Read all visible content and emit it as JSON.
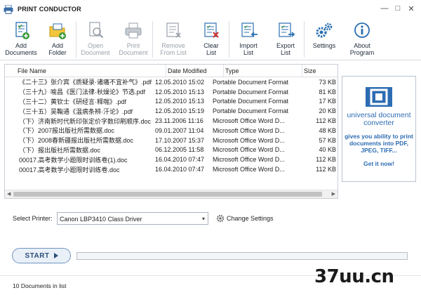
{
  "window": {
    "title": "PRINT CONDUCTOR",
    "minimize": "—",
    "restore": "□",
    "close": "✕"
  },
  "toolbar": [
    {
      "label": "Add\nDocuments",
      "icon": "add-documents-icon",
      "enabled": true
    },
    {
      "label": "Add\nFolder",
      "icon": "add-folder-icon",
      "enabled": true
    },
    {
      "label": "Open\nDocument",
      "icon": "open-document-icon",
      "enabled": false
    },
    {
      "label": "Print\nDocument",
      "icon": "print-document-icon",
      "enabled": false
    },
    {
      "label": "Remove\nFrom List",
      "icon": "remove-from-list-icon",
      "enabled": false
    },
    {
      "label": "Clear\nList",
      "icon": "clear-list-icon",
      "enabled": true
    },
    {
      "label": "Import\nList",
      "icon": "import-list-icon",
      "enabled": true
    },
    {
      "label": "Export\nList",
      "icon": "export-list-icon",
      "enabled": true
    },
    {
      "label": "Settings",
      "icon": "settings-icon",
      "enabled": true
    },
    {
      "label": "About\nProgram",
      "icon": "about-icon",
      "enabled": true
    }
  ],
  "table": {
    "columns": [
      "File Name",
      "Date Modified",
      "Type",
      "Size"
    ],
    "rows": [
      [
        "《二十三》张介宾《质疑录·诸痛不宜补气》.pdf",
        "12.05.2010 15:02",
        "Portable Document Format",
        "73 KB"
      ],
      [
        "（三十九）喻昌《医门法律·秋燥论》节选.pdf",
        "12.05.2010 15:13",
        "Portable Document Format",
        "81 KB"
      ],
      [
        "（三十二）黄钦士《研经言·释喘》.pdf",
        "12.05.2010 15:13",
        "Portable Document Format",
        "17 KB"
      ],
      [
        "（三十五）吴鞠通《温病条辨·汗论》.pdf",
        "12.05.2010 15:19",
        "Portable Document Format",
        "20 KB"
      ],
      [
        "（下）济南新时代新印张定价字数印刷顺序.doc",
        "23.11.2006 11:16",
        "Microsoft Office Word D...",
        "112 KB"
      ],
      [
        "（下）2007报出版社所需数据.doc",
        "09.01.2007 11:04",
        "Microsoft Office Word D...",
        "48 KB"
      ],
      [
        "（下）2008春新疆报出版社所需数据.doc",
        "17.10.2007 15:37",
        "Microsoft Office Word D...",
        "57 KB"
      ],
      [
        "（下）报出版社所需数据.doc",
        "06.12.2005 11:58",
        "Microsoft Office Word D...",
        "40 KB"
      ],
      [
        "00017.高考数学小题限时训练卷(1).doc",
        "16.04.2010 07:47",
        "Microsoft Office Word D...",
        "112 KB"
      ],
      [
        "00017.高考数学小题限时训练卷.doc",
        "16.04.2010 07:47",
        "Microsoft Office Word D...",
        "112 KB"
      ]
    ]
  },
  "ad": {
    "title": "universal document converter",
    "text": "gives you ability to print documents into PDF, JPEG, TIFF...",
    "cta": "Get it now!"
  },
  "printer": {
    "label": "Select Printer:",
    "value": "Canon LBP3410 Class Driver",
    "change_label": "Change Settings"
  },
  "start": {
    "label": "START",
    "progress": 0
  },
  "status": {
    "text": "10 Documents in list"
  },
  "watermark": "37uu.cn",
  "colors": {
    "accent": "#2d6cb3",
    "icon_blue": "#2a6fb0",
    "icon_green": "#3a9a3a",
    "icon_red": "#d0312d"
  }
}
